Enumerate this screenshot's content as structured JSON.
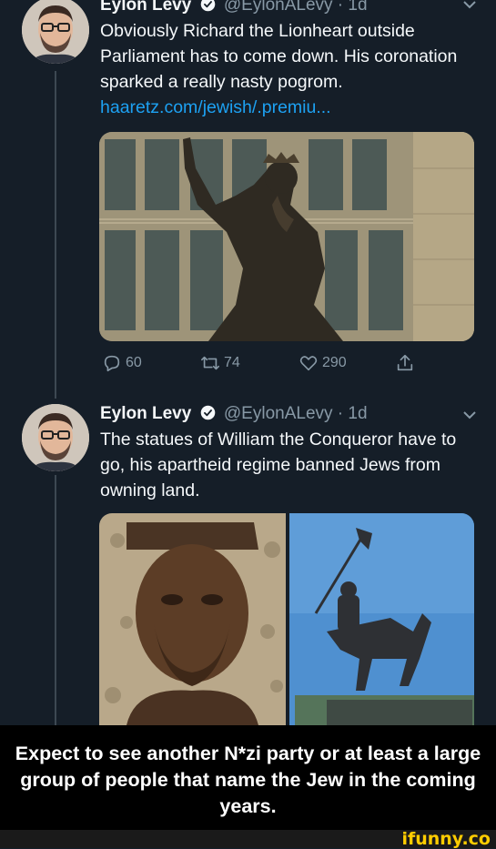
{
  "tweets": [
    {
      "name": "Eylon Levy",
      "handle": "@EylonALevy",
      "time": "1d",
      "text": "Obviously Richard the Lionheart outside Parliament has to come down. His coronation sparked a really nasty pogrom.",
      "link": "haaretz.com/jewish/.premiu...",
      "actions": {
        "replies": "60",
        "retweets": "74",
        "likes": "290"
      }
    },
    {
      "name": "Eylon Levy",
      "handle": "@EylonALevy",
      "time": "1d",
      "text": "The statues of William the Conqueror have to go, his apartheid regime banned Jews from owning land."
    }
  ],
  "meme_caption": "Expect to see another N*zi party or at least a large group of people that name the Jew in the coming years.",
  "watermark": "ifunny.co",
  "colors": {
    "background": "#151e28",
    "link": "#1da1f2",
    "muted": "#8899a6",
    "caption_bg": "#000000",
    "watermark": "#ffcc00"
  }
}
